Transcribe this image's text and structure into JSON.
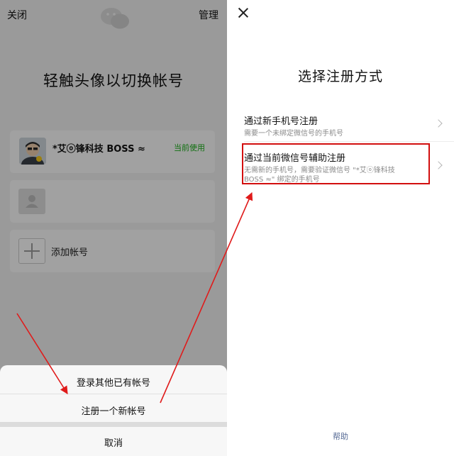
{
  "left": {
    "close_label": "关闭",
    "manage_label": "管理",
    "logo_icon": "wechat-logo-icon",
    "title": "轻触头像以切换帐号",
    "accounts": [
      {
        "name": "*艾ⓞ锋科技 BOSS ≈",
        "status": "当前使用"
      },
      {
        "name": ""
      }
    ],
    "add_account_label": "添加帐号"
  },
  "sheet": {
    "login_other": "登录其他已有帐号",
    "register_new": "注册一个新帐号",
    "cancel": "取消"
  },
  "right": {
    "close_icon": "close-icon",
    "title": "选择注册方式",
    "options": [
      {
        "title": "通过新手机号注册",
        "desc": "需要一个未绑定微信号的手机号"
      },
      {
        "title": "通过当前微信号辅助注册",
        "desc": "无需新的手机号，需要验证微信号 \"*艾ⓞ锋科技 BOSS ≈\" 绑定的手机号"
      }
    ],
    "help_label": "帮助"
  },
  "colors": {
    "accent_green": "#1aad19",
    "annotation_red": "#d20f0f",
    "link_blue": "#576b95",
    "dim_overlay": "rgba(0,0,0,0.35)"
  }
}
